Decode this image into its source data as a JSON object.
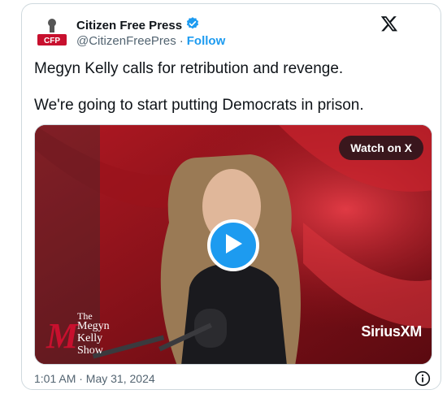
{
  "author": {
    "display_name": "Citizen Free Press",
    "handle": "@CitizenFreePres",
    "separator": "·",
    "follow_label": "Follow",
    "verified": true,
    "avatar_text": "CFP"
  },
  "tweet": {
    "lines": [
      "Megyn Kelly calls for retribution and revenge.",
      "We're going to start putting Democrats in prison."
    ]
  },
  "media": {
    "watch_label": "Watch on X",
    "show_logo": {
      "letter": "M",
      "line1": "The",
      "line2": "Megyn",
      "line3": "Kelly",
      "line4": "Show"
    },
    "network_logo": "SiriusXM"
  },
  "footer": {
    "timestamp": "1:01 AM · May 31, 2024"
  },
  "colors": {
    "accent": "#1d9bf0",
    "text": "#0f1419",
    "muted": "#536471",
    "video_bg": "#7a0f14"
  },
  "icons": [
    "verified-badge-icon",
    "x-logo-icon",
    "play-icon",
    "info-icon"
  ]
}
